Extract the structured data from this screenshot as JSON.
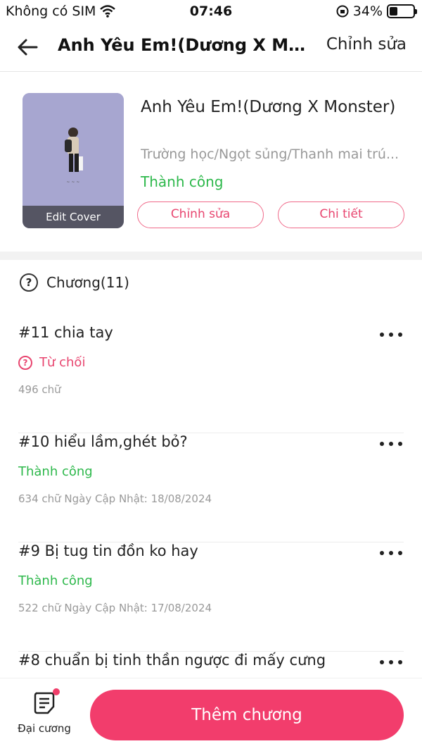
{
  "status_bar": {
    "carrier": "Không có SIM",
    "time": "07:46",
    "battery": "34%",
    "battery_level": 0.34
  },
  "nav": {
    "title": "Anh Yêu Em!(Dương X Mo...",
    "edit_label": "Chỉnh sửa"
  },
  "book": {
    "name": "Anh Yêu Em!(Dương X Monster)",
    "genres": "Trường học/Ngọt sủng/Thanh mai trú...",
    "status": "Thành công",
    "edit_cover": "Edit Cover",
    "edit_button": "Chỉnh sửa",
    "detail_button": "Chi tiết"
  },
  "chapters_header": {
    "label": "Chương(11)"
  },
  "chapters": [
    {
      "title": "#11 chia tay",
      "status": "Từ chối",
      "meta": "496 chữ"
    },
    {
      "title": "#10 hiểu lầm,ghét bỏ?",
      "status": "Thành công",
      "meta": "634 chữ Ngày Cập Nhật: 18/08/2024"
    },
    {
      "title": "#9 Bị tug tin đồn ko hay",
      "status": "Thành công",
      "meta": "522 chữ Ngày Cập Nhật: 17/08/2024"
    },
    {
      "title": "#8 chuẩn bị tinh thần ngược đi mấy cưng",
      "status": "",
      "meta": ""
    }
  ],
  "bottom": {
    "outline_label": "Đại cương",
    "add_chapter": "Thêm chương"
  },
  "colors": {
    "accent": "#f23d6c",
    "success": "#2db84b",
    "reject": "#e8456f"
  }
}
